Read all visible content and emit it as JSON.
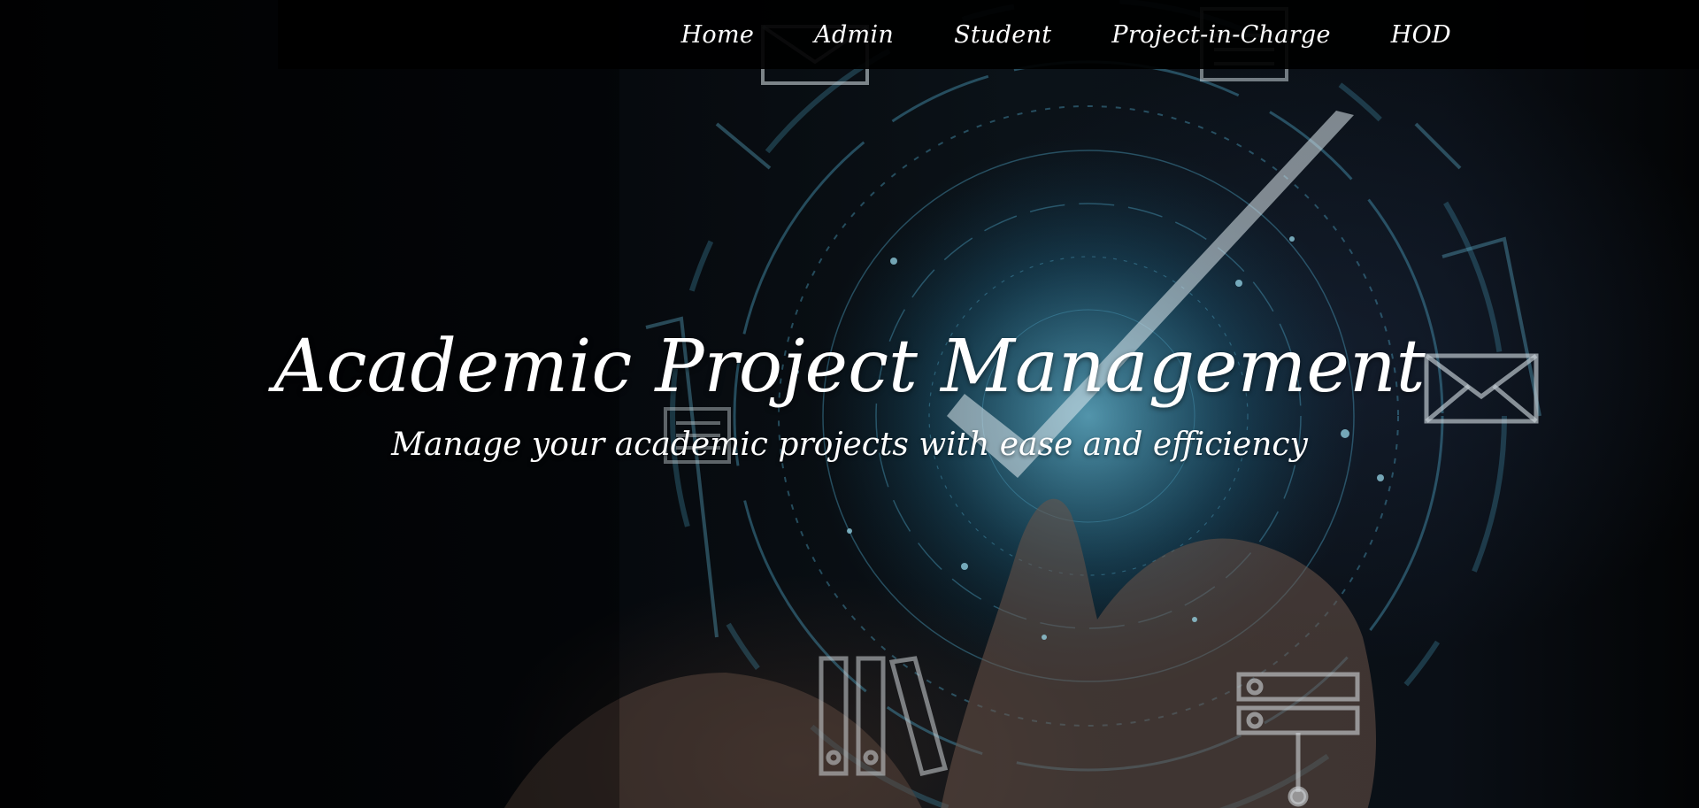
{
  "nav": {
    "items": [
      {
        "label": "Home"
      },
      {
        "label": "Admin"
      },
      {
        "label": "Student"
      },
      {
        "label": "Project-in-Charge"
      },
      {
        "label": "HOD"
      }
    ]
  },
  "hero": {
    "title": "Academic Project Management",
    "subtitle": "Manage your academic projects with ease and efficiency"
  },
  "colors": {
    "nav_background": "#000000",
    "text": "#ffffff",
    "accent_glow": "#3a8fb0"
  },
  "icons": [
    "checkmark-icon",
    "envelope-icon",
    "document-icon",
    "binders-icon",
    "server-icon"
  ]
}
